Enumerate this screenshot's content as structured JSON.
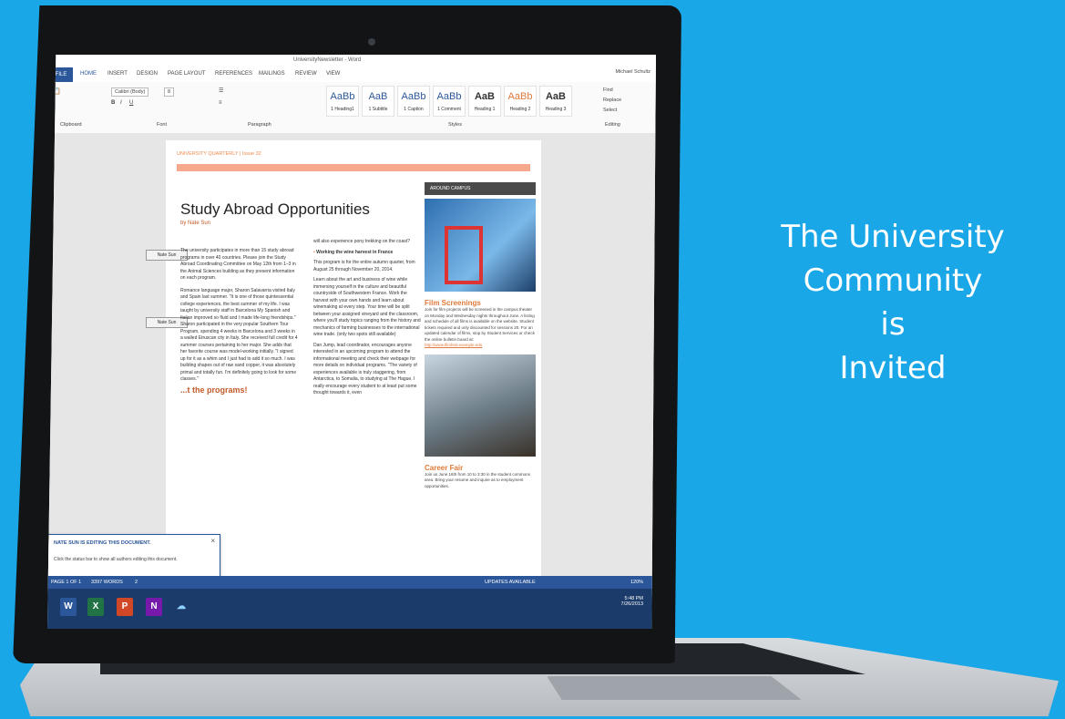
{
  "tagline": [
    "The University",
    "Community",
    "is",
    "Invited"
  ],
  "word": {
    "title": "UniversityNewsletter - Word",
    "tabs": [
      "FILE",
      "HOME",
      "INSERT",
      "DESIGN",
      "PAGE LAYOUT",
      "REFERENCES",
      "MAILINGS",
      "REVIEW",
      "VIEW"
    ],
    "account": "Michael Schultz",
    "groups": [
      "Clipboard",
      "Font",
      "Paragraph",
      "Styles",
      "Editing"
    ],
    "font_name": "Calibri (Body)",
    "font_size": "8",
    "styles": [
      "1 Heading1",
      "1 Subtitle",
      "1 Caption",
      "1 Caption2",
      "1 Comment",
      "Emphasis",
      "Heading 1",
      "Heading 2",
      "Heading 3"
    ],
    "editing": [
      "Find",
      "Replace",
      "Select"
    ]
  },
  "document": {
    "running_head": "UNIVERSITY QUARTERLY | Issue 32",
    "title": "Study Abroad Opportunities",
    "byline": "by Nate Sun",
    "comment_tag": "Nate Sun",
    "col1_para1": "The university participates in more than 15 study abroad programs in over 40 countries. Please join the Study Abroad Coordinating Committee on May 12th from 1–3 in the Animal Sciences building as they present information on each program.",
    "col1_para2": "Romance language major, Sharon Salavarria visited Italy and Spain last summer. \"It is one of those quintessential college experiences, the best summer of my life. I was taught by university staff in Barcelona My Spanish and Italian improved so fluid and I made life-long friendships.\" Sharon participated in the very popular Southern Tour Program, spending 4 weeks in Barcelona and 3 weeks in a walled Etruscan city in Italy. She received full credit for 4 summer courses pertaining to her major. She adds that her favorite course was model-working initially. \"I signed up for it as a whim and I just had to add it so much. I was building shapes out of raw sand copper, it was absolutely primal and totally fun. I'm definitely going to look for some classes.\"",
    "col1_subhead": "...t the programs!",
    "col2_intro": "will also experience pony trekking on the coast?",
    "col2_bullet": "Working the wine harvest in France",
    "col2_para1": "This program is for the entire autumn quarter, from August 25 through November 20, 2014.",
    "col2_para2": "Learn about the art and business of wine while immersing yourself in the culture and beautiful countryside of Southwestern France. Work the harvest with your own hands and learn about winemaking at every step. Your time will be split between your assigned vineyard and the classroom, where you'll study topics ranging from the history and mechanics of farming businesses to the international wine trade. (only two spots still available)",
    "col2_para3": "Dan Jump, lead coordinator, encourages anyone interested in an upcoming program to attend the informational meeting and check their webpage for more details on individual programs. \"The variety of experiences available is truly staggering, from Antarctica, to Somalia, to studying at The Hague. I really encourage every student to at least put some thought towards it, even",
    "sidebar_header": "AROUND CAMPUS",
    "film_title": "Film Screenings",
    "film_text": "Join for film projects will be screened in the campus theater on Monday and Wednesday nights throughout June. A listing and schedule of all films is available on the website. Student tickets required and only discounted for sessions 20. For an updated calendar of films, stop by Student Services or check the online bulletin board at:",
    "film_link": "http://www.filmfest.example.edu",
    "career_title": "Career Fair",
    "career_text": "Join us June 16th from 10 to 3:30 in the student commons area. Bring your resume and inquire as to employment opportunities."
  },
  "notification": {
    "title": "NATE SUN IS EDITING THIS DOCUMENT.",
    "body": "Click the status bar to show all authors editing this document.",
    "close": "×"
  },
  "statusbar": {
    "page": "PAGE 1 OF 1",
    "words": "3397 WORDS",
    "authors": "2",
    "updates": "UPDATES AVAILABLE",
    "zoom": "120%"
  },
  "taskbar": {
    "apps": [
      "W",
      "X",
      "P",
      "N",
      "☁"
    ],
    "time": "5:48 PM",
    "date": "7/26/2013"
  },
  "colors": {
    "background": "#1aa7e8",
    "word_blue": "#2b579a",
    "accent_orange": "#e07a3a"
  }
}
